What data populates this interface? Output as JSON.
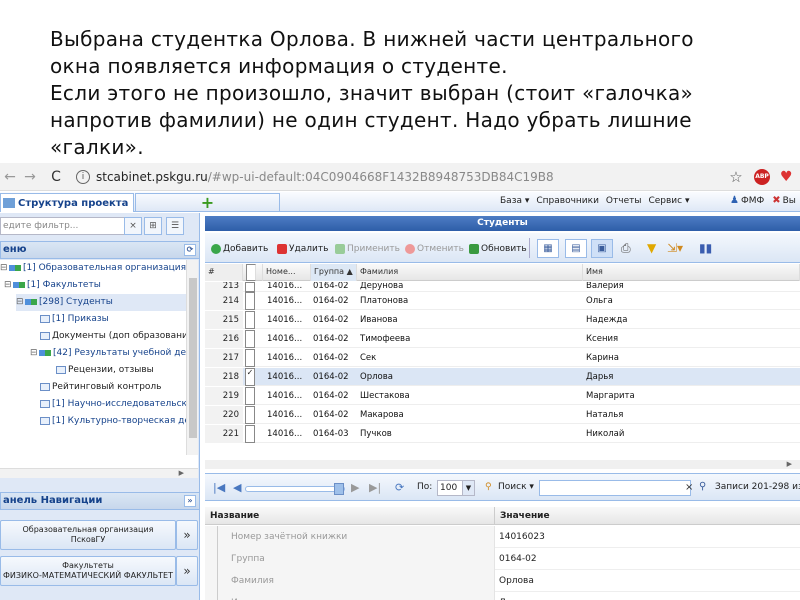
{
  "caption": {
    "line1": "Выбрана студентка Орлова. В нижней части центрального",
    "line2": "окна появляется информация о студенте.",
    "line3": "Если этого не произошло, значит выбран (стоит «галочка»",
    "line4": "напротив фамилии) не один студент. Надо убрать лишние",
    "line5": "«галки»."
  },
  "browser": {
    "back": "←",
    "forward": "→",
    "reload": "C",
    "url_host": "stcabinet.pskgu.ru",
    "url_rest": "/#wp-ui-default:04C0904668F1432B8948753DB84C19B8",
    "star": "☆",
    "abp": "ABP",
    "ext": "♥"
  },
  "app_toolbar": {
    "tab_label": "Структура проекта",
    "add_tab": "+",
    "menu": [
      "База ▾",
      "Справочники",
      "Отчеты",
      "Сервис ▾"
    ],
    "user": "ФМФ",
    "exit": "Вы"
  },
  "left": {
    "filter_placeholder": "едите фильтр...",
    "filter_clear": "×",
    "filter_btn1": "⊞",
    "filter_btn2": "☰",
    "menu_header": "еню",
    "header_tool": "⟳",
    "tree": [
      {
        "toggle": "⊟",
        "label": "[1] Образовательная организация"
      },
      {
        "toggle": "⊟",
        "label": "[1] Факультеты"
      },
      {
        "toggle": "⊟",
        "label": "[298] Студенты"
      },
      {
        "toggle": "",
        "label": "[1] Приказы"
      },
      {
        "toggle": "",
        "label": "Документы (доп образование"
      },
      {
        "toggle": "⊟",
        "label": "[42] Результаты учебной деят"
      },
      {
        "toggle": "",
        "label": "Рецензии, отзывы"
      },
      {
        "toggle": "",
        "label": "Рейтинговый контроль"
      },
      {
        "toggle": "",
        "label": "[1] Научно-исследовательска"
      },
      {
        "toggle": "",
        "label": "[1] Культурно-творческая дея"
      }
    ],
    "tree_scroll": "▶",
    "nav_header": "анель Навигации",
    "nav_tool": "»",
    "cards": [
      {
        "title": "Образовательная организация",
        "sub": "ПсковГУ",
        "btn": "»"
      },
      {
        "title": "Факультеты",
        "sub": "ФИЗИКО-МАТЕМАТИЧЕСКИЙ ФАКУЛЬТЕТ",
        "btn": "»"
      }
    ]
  },
  "main": {
    "title": "Студенты",
    "toolbar": {
      "add": "Добавить",
      "delete": "Удалить",
      "apply": "Применить",
      "cancel": "Отменить",
      "refresh": "Обновить"
    },
    "columns": [
      "#",
      "",
      "Номе...",
      "Группа ▲",
      "Фамилия",
      "Имя"
    ],
    "rows": [
      {
        "n": "213",
        "checked": "",
        "num": "14016...",
        "group": "0164-02",
        "last": "Дерунова",
        "first": "Валерия"
      },
      {
        "n": "214",
        "checked": "",
        "num": "14016...",
        "group": "0164-02",
        "last": "Платонова",
        "first": "Ольга"
      },
      {
        "n": "215",
        "checked": "",
        "num": "14016...",
        "group": "0164-02",
        "last": "Иванова",
        "first": "Надежда"
      },
      {
        "n": "216",
        "checked": "",
        "num": "14016...",
        "group": "0164-02",
        "last": "Тимофеева",
        "first": "Ксения"
      },
      {
        "n": "217",
        "checked": "",
        "num": "14016...",
        "group": "0164-02",
        "last": "Сек",
        "first": "Карина"
      },
      {
        "n": "218",
        "checked": "✓",
        "num": "14016...",
        "group": "0164-02",
        "last": "Орлова",
        "first": "Дарья"
      },
      {
        "n": "219",
        "checked": "",
        "num": "14016...",
        "group": "0164-02",
        "last": "Шестакова",
        "first": "Маргарита"
      },
      {
        "n": "220",
        "checked": "",
        "num": "14016...",
        "group": "0164-02",
        "last": "Макарова",
        "first": "Наталья"
      },
      {
        "n": "221",
        "checked": "",
        "num": "14016...",
        "group": "0164-03",
        "last": "Пучков",
        "first": "Николай"
      }
    ],
    "hscroll": "▶",
    "pager": {
      "first": "|◀",
      "prev": "◀",
      "next": "▶",
      "last": "▶|",
      "refresh": "⟳",
      "per_page_label": "По:",
      "per_page": "100",
      "search_label": "Поиск ▾",
      "clear": "×",
      "records": "Записи 201-298 из"
    },
    "details": {
      "col_name": "Название",
      "col_value": "Значение",
      "rows": [
        {
          "k": "Номер зачётной книжки",
          "v": "14016023"
        },
        {
          "k": "Группа",
          "v": "0164-02"
        },
        {
          "k": "Фамилия",
          "v": "Орлова"
        },
        {
          "k": "Имя",
          "v": "Дарья"
        }
      ]
    }
  }
}
